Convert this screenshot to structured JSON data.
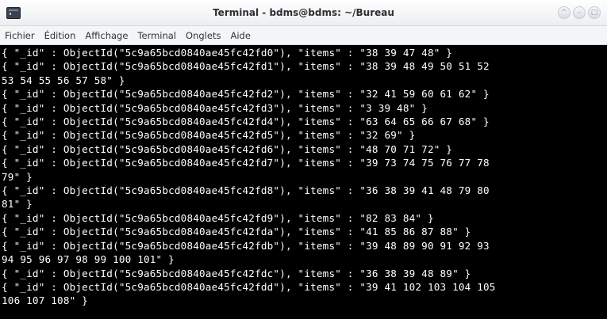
{
  "window": {
    "title": "Terminal - bdms@bdms: ~/Bureau",
    "buttons": [
      "^",
      "–",
      "□"
    ]
  },
  "menu": [
    "Fichier",
    "Édition",
    "Affichage",
    "Terminal",
    "Onglets",
    "Aide"
  ],
  "terminal": {
    "lines": [
      "{ \"_id\" : ObjectId(\"5c9a65bcd0840ae45fc42fd0\"), \"items\" : \"38 39 47 48\" }",
      "{ \"_id\" : ObjectId(\"5c9a65bcd0840ae45fc42fd1\"), \"items\" : \"38 39 48 49 50 51 52",
      "53 54 55 56 57 58\" }",
      "{ \"_id\" : ObjectId(\"5c9a65bcd0840ae45fc42fd2\"), \"items\" : \"32 41 59 60 61 62\" }",
      "{ \"_id\" : ObjectId(\"5c9a65bcd0840ae45fc42fd3\"), \"items\" : \"3 39 48\" }",
      "{ \"_id\" : ObjectId(\"5c9a65bcd0840ae45fc42fd4\"), \"items\" : \"63 64 65 66 67 68\" }",
      "{ \"_id\" : ObjectId(\"5c9a65bcd0840ae45fc42fd5\"), \"items\" : \"32 69\" }",
      "{ \"_id\" : ObjectId(\"5c9a65bcd0840ae45fc42fd6\"), \"items\" : \"48 70 71 72\" }",
      "{ \"_id\" : ObjectId(\"5c9a65bcd0840ae45fc42fd7\"), \"items\" : \"39 73 74 75 76 77 78",
      "79\" }",
      "{ \"_id\" : ObjectId(\"5c9a65bcd0840ae45fc42fd8\"), \"items\" : \"36 38 39 41 48 79 80",
      "81\" }",
      "{ \"_id\" : ObjectId(\"5c9a65bcd0840ae45fc42fd9\"), \"items\" : \"82 83 84\" }",
      "{ \"_id\" : ObjectId(\"5c9a65bcd0840ae45fc42fda\"), \"items\" : \"41 85 86 87 88\" }",
      "{ \"_id\" : ObjectId(\"5c9a65bcd0840ae45fc42fdb\"), \"items\" : \"39 48 89 90 91 92 93",
      "94 95 96 97 98 99 100 101\" }",
      "{ \"_id\" : ObjectId(\"5c9a65bcd0840ae45fc42fdc\"), \"items\" : \"36 38 39 48 89\" }",
      "{ \"_id\" : ObjectId(\"5c9a65bcd0840ae45fc42fdd\"), \"items\" : \"39 41 102 103 104 105",
      "106 107 108\" }"
    ]
  }
}
